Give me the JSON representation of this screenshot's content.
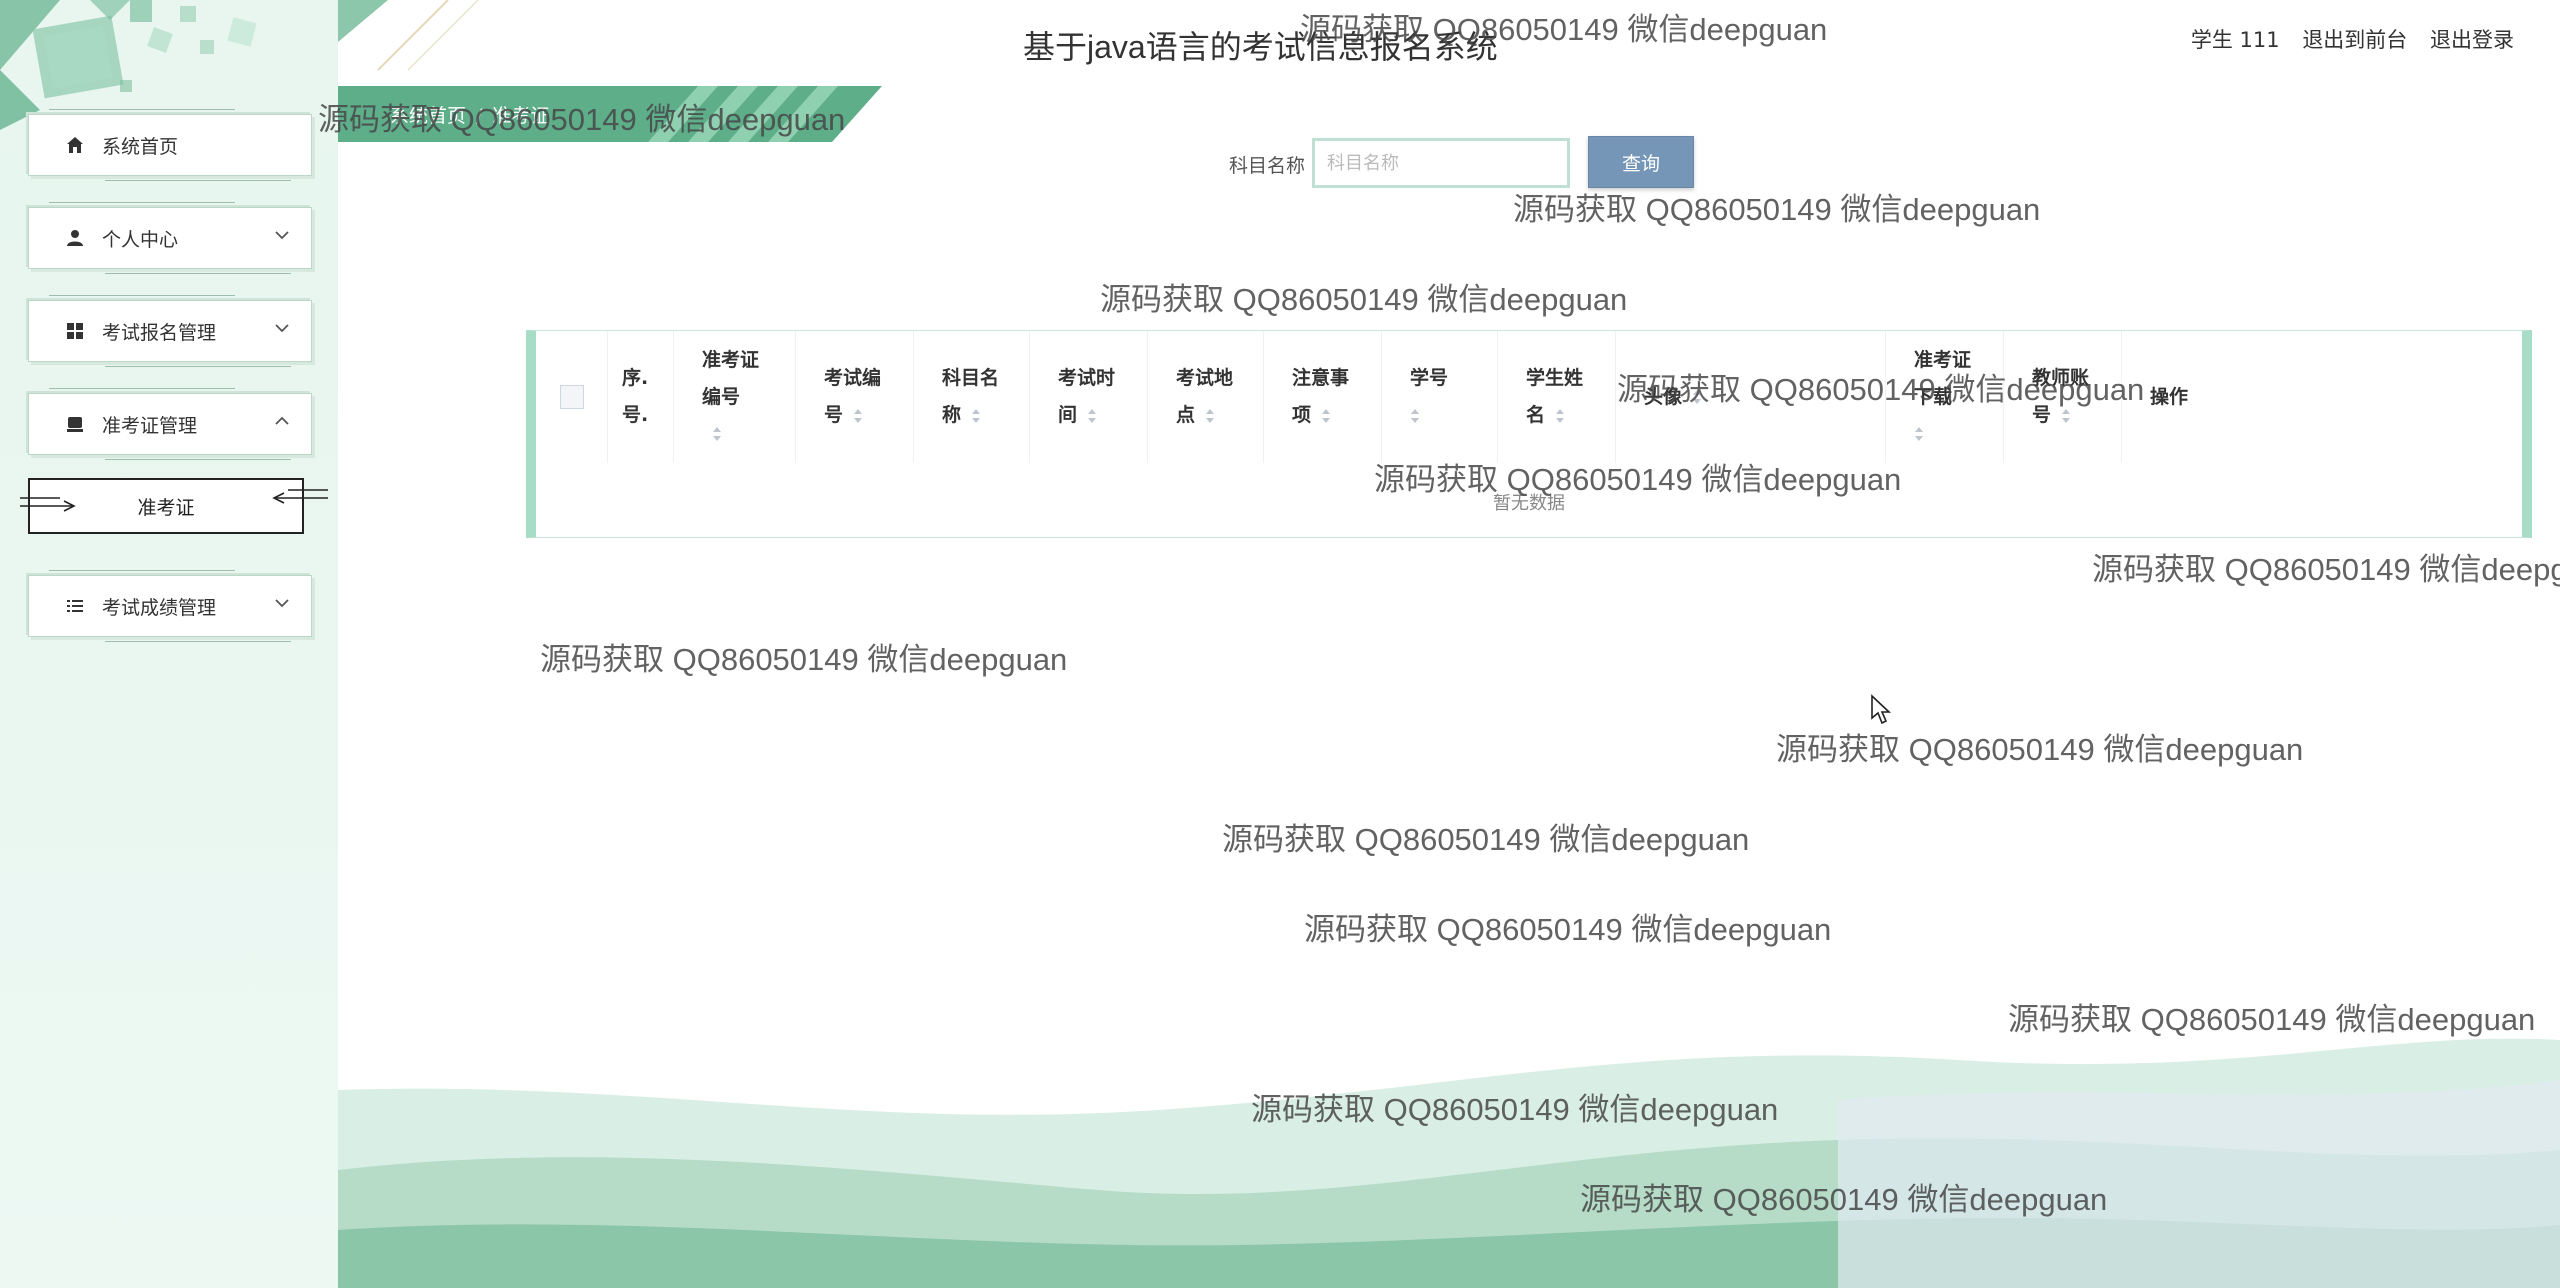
{
  "app": {
    "title": "基于java语言的考试信息报名系统",
    "accent": "#a7dcc6",
    "brand_green": "#5fae8a",
    "button_blue": "#7696b8"
  },
  "user_area": {
    "user_name": "学生 111",
    "to_frontend": "退出到前台",
    "logout": "退出登录"
  },
  "breadcrumb": {
    "home": "系统首页",
    "current": "准考证"
  },
  "sidebar": {
    "items": [
      {
        "label": "系统首页",
        "icon": "home-icon"
      },
      {
        "label": "个人中心",
        "icon": "user-icon",
        "expandable": true
      },
      {
        "label": "考试报名管理",
        "icon": "grid-icon",
        "expandable": true
      },
      {
        "label": "准考证管理",
        "icon": "card-icon",
        "expandable": true,
        "expanded": true
      },
      {
        "label": "考试成绩管理",
        "icon": "list-icon",
        "expandable": true
      }
    ],
    "sub_item": "准考证"
  },
  "search": {
    "label": "科目名称",
    "placeholder": "科目名称",
    "value": "",
    "button": "查询"
  },
  "table": {
    "columns": [
      {
        "line1": "序.",
        "line2": "号."
      },
      {
        "line1": "准考证",
        "line2": "编号",
        "sortable": true
      },
      {
        "line1": "考试编",
        "line2": "号",
        "sortable": true
      },
      {
        "line1": "科目名",
        "line2": "称",
        "sortable": true
      },
      {
        "line1": "考试时",
        "line2": "间",
        "sortable": true
      },
      {
        "line1": "考试地",
        "line2": "点",
        "sortable": true
      },
      {
        "line1": "注意事",
        "line2": "项",
        "sortable": true
      },
      {
        "line1": "学号",
        "line2": "",
        "sortable": true
      },
      {
        "line1": "学生姓",
        "line2": "名",
        "sortable": true
      },
      {
        "line1": "头像",
        "line2": "",
        "sortable": true
      },
      {
        "line1": "准考证",
        "line2": "下载",
        "sortable": true
      },
      {
        "line1": "教师账",
        "line2": "号",
        "sortable": true
      },
      {
        "line1": "操作",
        "line2": ""
      }
    ],
    "rows": [],
    "empty_text": "暂无数据"
  },
  "watermark": "源码获取 QQ86050149 微信deepguan"
}
